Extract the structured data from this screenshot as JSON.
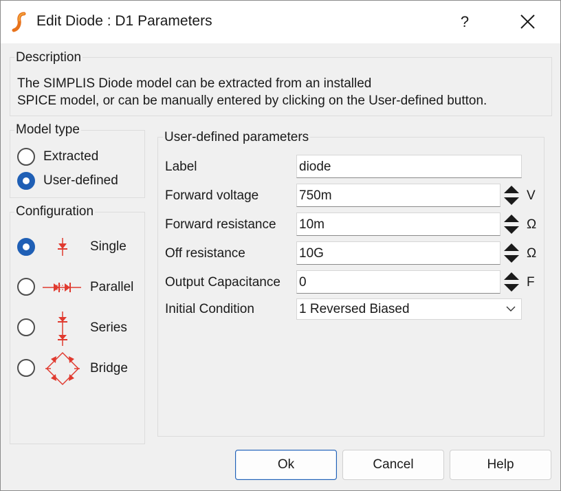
{
  "window": {
    "title": "Edit Diode : D1 Parameters",
    "help_label": "?"
  },
  "description": {
    "group_title": "Description",
    "line1": "The SIMPLIS Diode model can be extracted from an installed",
    "line2": "SPICE model, or can be manually entered by clicking on the User-defined button."
  },
  "model_type": {
    "group_title": "Model type",
    "options": [
      {
        "label": "Extracted",
        "checked": false
      },
      {
        "label": "User-defined",
        "checked": true
      }
    ]
  },
  "configuration": {
    "group_title": "Configuration",
    "options": [
      {
        "label": "Single",
        "checked": true,
        "icon": "single-diode-icon"
      },
      {
        "label": "Parallel",
        "checked": false,
        "icon": "parallel-diode-icon"
      },
      {
        "label": "Series",
        "checked": false,
        "icon": "series-diode-icon"
      },
      {
        "label": "Bridge",
        "checked": false,
        "icon": "bridge-diode-icon"
      }
    ]
  },
  "parameters": {
    "group_title": "User-defined parameters",
    "label": {
      "name": "Label",
      "value": "diode"
    },
    "forward_voltage": {
      "name": "Forward voltage",
      "value": "750m",
      "unit": "V"
    },
    "forward_resistance": {
      "name": "Forward resistance",
      "value": "10m",
      "unit": "Ω"
    },
    "off_resistance": {
      "name": "Off resistance",
      "value": "10G",
      "unit": "Ω"
    },
    "output_capacitance": {
      "name": "Output Capacitance",
      "value": "0",
      "unit": "F"
    },
    "initial_condition": {
      "name": "Initial Condition",
      "value": "1 Reversed Biased"
    }
  },
  "buttons": {
    "ok": "Ok",
    "cancel": "Cancel",
    "help": "Help"
  },
  "colors": {
    "accent": "#1f5fb5",
    "diode_red": "#e03a2f",
    "app_icon": "#e8731c"
  }
}
